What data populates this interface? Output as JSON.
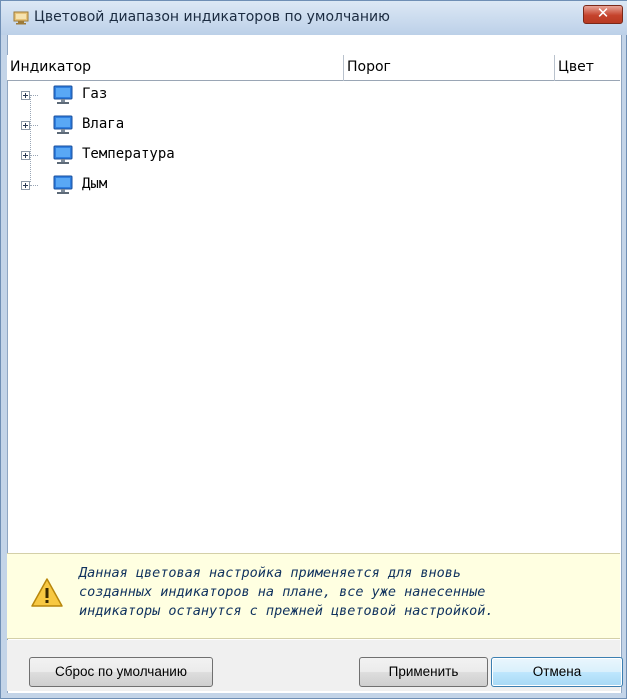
{
  "window": {
    "title": "Цветовой диапазон индикаторов по умолчанию",
    "close_label": "✕"
  },
  "columns": {
    "indicator": "Индикатор",
    "threshold": "Порог",
    "color": "Цвет"
  },
  "tree": {
    "items": [
      {
        "label": "Газ",
        "icon": "monitor-icon"
      },
      {
        "label": "Влага",
        "icon": "monitor-icon"
      },
      {
        "label": "Температура",
        "icon": "monitor-icon"
      },
      {
        "label": "Дым",
        "icon": "monitor-icon"
      }
    ]
  },
  "warning": {
    "icon": "warning-icon",
    "line1": "Данная цветовая настройка применяется для вновь",
    "line2": "созданных индикаторов на плане, все уже нанесенные",
    "line3": "индикаторы останутся с прежней цветовой настройкой."
  },
  "buttons": {
    "reset": "Сброс по умолчанию",
    "apply": "Применить",
    "cancel": "Отмена"
  },
  "colors": {
    "accent": "#3c7fb1",
    "warning_bg": "#ffffe1",
    "warning_text": "#10325e",
    "titlebar": "#c3d4e8"
  }
}
